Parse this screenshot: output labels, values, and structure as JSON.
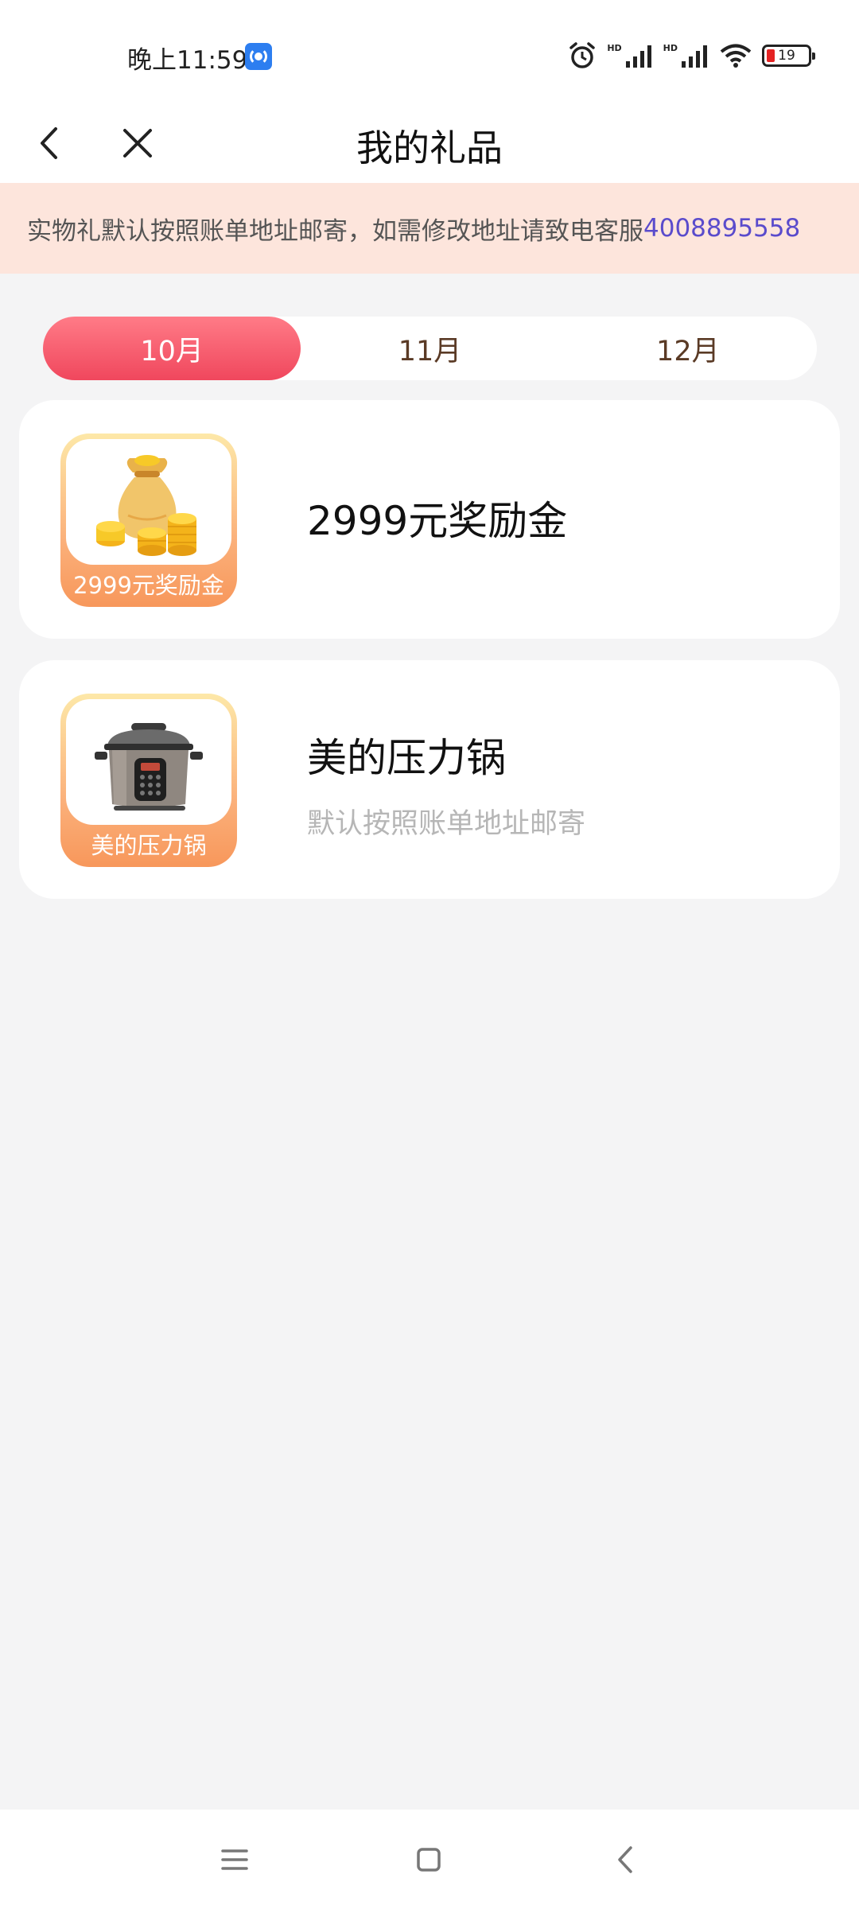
{
  "status_bar": {
    "time": "晚上11:59",
    "hd_1": "HD",
    "hd_2": "HD",
    "battery_level": "19",
    "battery_color": "#e42323"
  },
  "nav": {
    "title": "我的礼品",
    "back_icon": "chevron-left-icon",
    "close_icon": "close-icon"
  },
  "notice": {
    "text": "实物礼默认按照账单地址邮寄，如需修改地址请致电客服",
    "phone": "4008895558"
  },
  "tabs": [
    {
      "label": "10月",
      "active": true
    },
    {
      "label": "11月",
      "active": false
    },
    {
      "label": "12月",
      "active": false
    }
  ],
  "gifts": [
    {
      "title": "2999元奖励金",
      "thumb_label": "2999元奖励金",
      "subtitle": "",
      "icon": "money-bag-icon"
    },
    {
      "title": "美的压力锅",
      "thumb_label": "美的压力锅",
      "subtitle": "默认按照账单地址邮寄",
      "icon": "pressure-cooker-icon"
    }
  ],
  "colors": {
    "accent": "#f0475d",
    "notice_bg": "#fde5dc",
    "phone_link": "#5a4bcc"
  }
}
